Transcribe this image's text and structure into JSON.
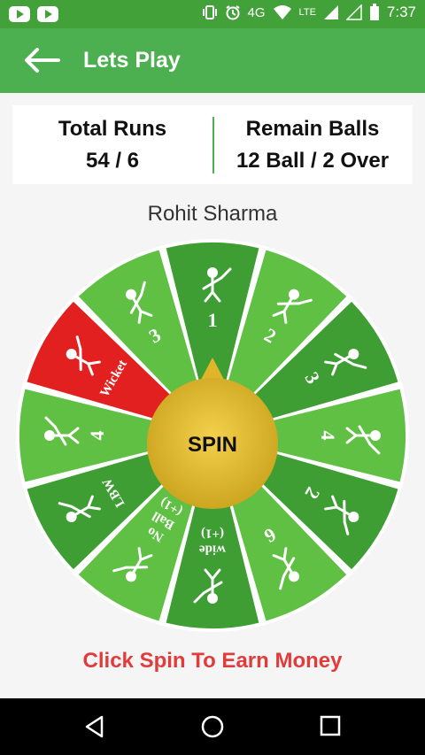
{
  "status_bar": {
    "time": "7:37",
    "network": "LTE",
    "icons": [
      "youtube-icon",
      "youtube-icon",
      "vibrate-icon",
      "alarm-icon",
      "volte-4g-icon",
      "wifi-icon",
      "signal-icon",
      "signal-icon",
      "battery-icon"
    ],
    "volte_label": "4G"
  },
  "app_bar": {
    "title": "Lets Play",
    "back_icon": "arrow-left-icon"
  },
  "score": {
    "total_runs_label": "Total Runs",
    "total_runs_value": "54 / 6",
    "remain_balls_label": "Remain Balls",
    "remain_balls_value": "12 Ball / 2 Over"
  },
  "player_name": "Rohit Sharma",
  "wheel": {
    "center_label": "SPIN",
    "segments": [
      {
        "label": "1",
        "color": "#3e9e34"
      },
      {
        "label": "2",
        "color": "#5fc043"
      },
      {
        "label": "3",
        "color": "#3e9e34"
      },
      {
        "label": "4",
        "color": "#5fc043"
      },
      {
        "label": "2",
        "color": "#3e9e34"
      },
      {
        "label": "6",
        "color": "#5fc043"
      },
      {
        "label": "wide",
        "extra": "(+1)",
        "color": "#3e9e34"
      },
      {
        "label": "No",
        "extra": "Ball",
        "extra2": "(+1)",
        "color": "#5fc043"
      },
      {
        "label": "LBW",
        "color": "#3e9e34"
      },
      {
        "label": "4",
        "color": "#5fc043"
      },
      {
        "label": "Wicket",
        "color": "#e32020"
      },
      {
        "label": "3",
        "color": "#5fc043"
      }
    ],
    "colors": {
      "dark_green": "#3e9e34",
      "light_green": "#5fc043",
      "red": "#e32020",
      "gold": "#e0b628"
    }
  },
  "earn_text": "Click Spin To Earn Money",
  "nav": {
    "back_icon": "triangle-back-icon",
    "home_icon": "circle-home-icon",
    "recents_icon": "square-recents-icon"
  },
  "colors": {
    "primary": "#4caf50",
    "status_bar": "#43a13a",
    "accent_red": "#e23b3b"
  }
}
